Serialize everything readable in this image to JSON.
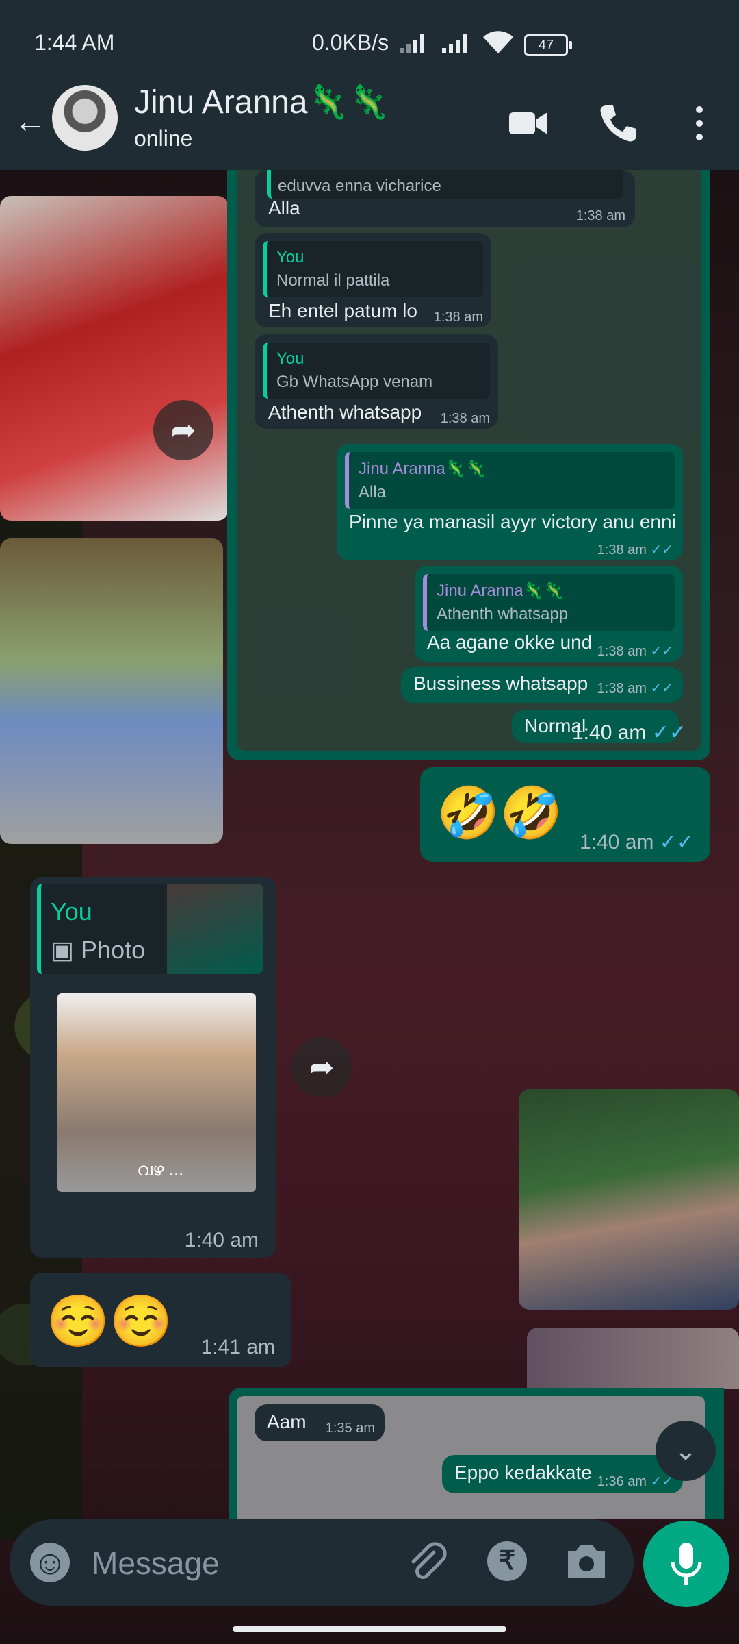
{
  "status": {
    "time": "1:44 AM",
    "network": "0.0KB/s",
    "battery": "47"
  },
  "header": {
    "name": "Jinu Aranna🦎🦎",
    "status": "online"
  },
  "top_messages": [
    {
      "kind": "in",
      "quote_text": "eduvva enna vicharice",
      "text": "Alla",
      "time": "1:38 am"
    },
    {
      "kind": "in",
      "quote_name": "You",
      "quote_text": "Normal il pattila",
      "text": "Eh entel patum lo",
      "time": "1:38 am"
    },
    {
      "kind": "in",
      "quote_name": "You",
      "quote_text": "Gb WhatsApp venam",
      "text": "Athenth whatsapp",
      "time": "1:38 am"
    },
    {
      "kind": "out",
      "quote_name": "Jinu Aranna🦎🦎",
      "quote_text": "Alla",
      "text": "Pinne ya manasil ayyr victory anu enni",
      "time": "1:38 am"
    },
    {
      "kind": "out",
      "quote_name": "Jinu Aranna🦎🦎",
      "quote_text": "Athenth whatsapp",
      "text": "Aa agane okke und",
      "time": "1:38 am"
    },
    {
      "kind": "out",
      "text": "Bussiness whatsapp",
      "time": "1:38 am"
    },
    {
      "kind": "out",
      "text": "Normal",
      "time": "1:40 am"
    }
  ],
  "emoji_out": {
    "text": "🤣🤣",
    "time": "1:40 am"
  },
  "reply_sticker": {
    "quote_name": "You",
    "quote_text": "Photo",
    "sticker_caption": "വഴ ...",
    "time": "1:40 am"
  },
  "emoji_in": {
    "text": "☺️☺️",
    "time": "1:41 am"
  },
  "bottom_messages": [
    {
      "kind": "in",
      "text": "Aam",
      "time": "1:35 am"
    },
    {
      "kind": "out",
      "text": "Eppo kedakkate",
      "time": "1:36 am"
    }
  ],
  "composer": {
    "placeholder": "Message",
    "rupee": "₹"
  },
  "colors": {
    "outgoing": "#005c4b",
    "incoming": "#202c33",
    "accent": "#00a884",
    "read_ticks": "#53bdeb"
  }
}
